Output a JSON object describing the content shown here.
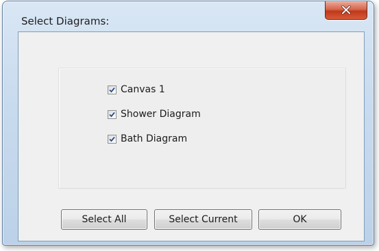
{
  "window": {
    "title": "Select Diagrams:"
  },
  "title_bar": {
    "close_icon": "close-icon",
    "close_button_color": "#c7432a"
  },
  "diagrams": [
    {
      "label": "Canvas 1",
      "checked": true
    },
    {
      "label": "Shower Diagram",
      "checked": true
    },
    {
      "label": "Bath Diagram",
      "checked": true
    }
  ],
  "buttons": {
    "select_all": "Select All",
    "select_current": "Select Current",
    "ok": "OK"
  }
}
